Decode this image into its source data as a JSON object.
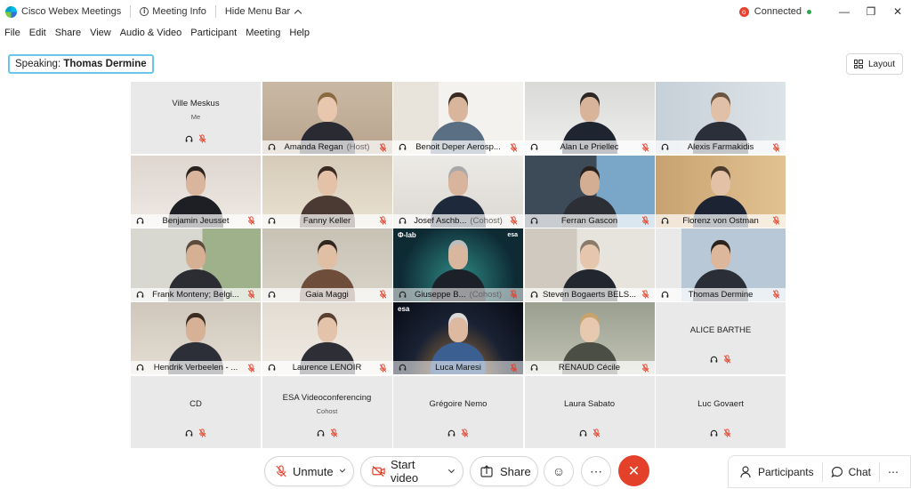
{
  "titlebar": {
    "app_name": "Cisco Webex Meetings",
    "meeting_info": "Meeting Info",
    "hide_menu": "Hide Menu Bar",
    "status": "Connected"
  },
  "menu": [
    "File",
    "Edit",
    "Share",
    "View",
    "Audio & Video",
    "Participant",
    "Meeting",
    "Help"
  ],
  "speaking": {
    "label": "Speaking:",
    "name": "Thomas Dermine"
  },
  "layout_label": "Layout",
  "tiles": [
    {
      "name": "Ville Meskus",
      "sub": "Me"
    },
    {
      "name": "Amanda Regan",
      "role": "(Host)"
    },
    {
      "name": "Benoit Deper Aerosp..."
    },
    {
      "name": "Alan Le Priellec"
    },
    {
      "name": "Alexis Farmakidis"
    },
    {
      "name": "Benjamin Jeusset"
    },
    {
      "name": "Fanny Keller"
    },
    {
      "name": "Josef Aschb...",
      "role": "(Cohost)"
    },
    {
      "name": "Ferran Gascon"
    },
    {
      "name": "Florenz von Ostman"
    },
    {
      "name": "Frank Monteny; Belgi..."
    },
    {
      "name": "Gaia Maggi"
    },
    {
      "name": "Giuseppe B...",
      "role": "(Cohost)",
      "overlay_left": "Φ-lab",
      "overlay_right": "esa"
    },
    {
      "name": "Steven Bogaerts BELS..."
    },
    {
      "name": "Thomas Dermine"
    },
    {
      "name": "Hendrik Verbeelen - ..."
    },
    {
      "name": "Laurence LENOIR"
    },
    {
      "name": "Luca Maresi",
      "overlay_left": "esa"
    },
    {
      "name": "RENAUD Cécile"
    },
    {
      "name": "ALICE BARTHE"
    },
    {
      "name": "CD"
    },
    {
      "name": "ESA Videoconferencing",
      "sub": "Cohost"
    },
    {
      "name": "Grégoire Nemo"
    },
    {
      "name": "Laura Sabato"
    },
    {
      "name": "Luc Govaert"
    }
  ],
  "controls": {
    "unmute": "Unmute",
    "start_video": "Start video",
    "share": "Share",
    "participants": "Participants",
    "chat": "Chat"
  },
  "colors": {
    "accent": "#1da6e0",
    "end_call": "#e3412a",
    "mute_red": "#e3412a"
  }
}
